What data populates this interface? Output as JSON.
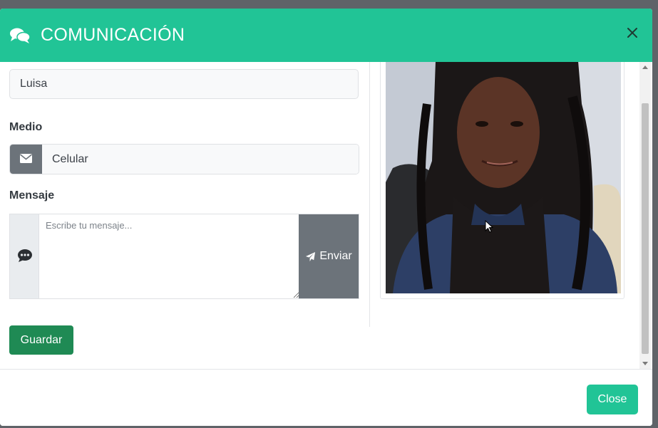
{
  "header": {
    "title": "COMUNICACIÓN",
    "icon": "comments-icon",
    "close_icon": "close-icon"
  },
  "form": {
    "name_value": "Luisa",
    "medio_label": "Medio",
    "medio_value": "Celular",
    "medio_icon": "envelope-icon",
    "mensaje_label": "Mensaje",
    "mensaje_placeholder": "Escribe tu mensaje...",
    "mensaje_icon": "chat-bubble-icon",
    "send_label": "Enviar",
    "send_icon": "paper-plane-icon",
    "save_label": "Guardar"
  },
  "footer": {
    "close_label": "Close"
  },
  "colors": {
    "accent": "#21c496",
    "save_button": "#1f8a54",
    "addon_gray": "#6c737a"
  }
}
